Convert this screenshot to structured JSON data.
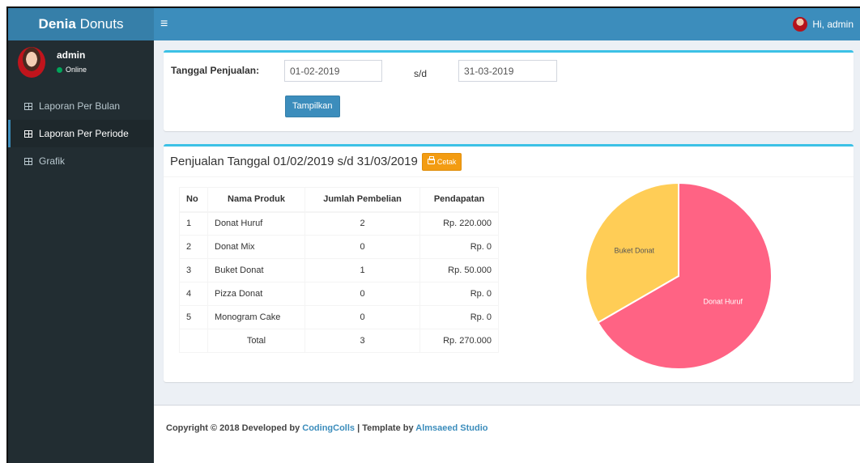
{
  "header": {
    "brand_bold": "Denia",
    "brand_rest": "Donuts",
    "menu_icon": "≡",
    "greeting": "Hi, admin"
  },
  "sidebar": {
    "user_name": "admin",
    "status": "Online",
    "items": [
      {
        "label": "Laporan Per Bulan",
        "active": false
      },
      {
        "label": "Laporan Per Periode",
        "active": true
      },
      {
        "label": "Grafik",
        "active": false
      }
    ]
  },
  "filter": {
    "label": "Tanggal Penjualan:",
    "date_from": "01-02-2019",
    "separator": "s/d",
    "date_to": "31-03-2019",
    "submit_label": "Tampilkan"
  },
  "report": {
    "title": "Penjualan Tanggal 01/02/2019 s/d 31/03/2019",
    "print_label": "Cetak",
    "columns": [
      "No",
      "Nama Produk",
      "Jumlah Pembelian",
      "Pendapatan"
    ],
    "rows": [
      {
        "no": "1",
        "name": "Donat Huruf",
        "qty": "2",
        "revenue": "Rp. 220.000"
      },
      {
        "no": "2",
        "name": "Donat Mix",
        "qty": "0",
        "revenue": "Rp. 0"
      },
      {
        "no": "3",
        "name": "Buket Donat",
        "qty": "1",
        "revenue": "Rp. 50.000"
      },
      {
        "no": "4",
        "name": "Pizza Donat",
        "qty": "0",
        "revenue": "Rp. 0"
      },
      {
        "no": "5",
        "name": "Monogram Cake",
        "qty": "0",
        "revenue": "Rp. 0"
      }
    ],
    "total": {
      "label": "Total",
      "qty": "3",
      "revenue": "Rp. 270.000"
    }
  },
  "chart_data": {
    "type": "pie",
    "categories": [
      "Donat Huruf",
      "Buket Donat"
    ],
    "values": [
      2,
      1
    ],
    "colors": [
      "#ff6384",
      "#ffcd56"
    ]
  },
  "footer": {
    "prefix": "Copyright © 2018 Developed by ",
    "dev": "CodingColls",
    "mid": " | Template by ",
    "template": "Almsaeed Studio"
  },
  "colors": {
    "primary": "#3c8dbc",
    "sidebar": "#222d32",
    "accent_top": "#3cc1e6",
    "warning": "#f39c12"
  }
}
